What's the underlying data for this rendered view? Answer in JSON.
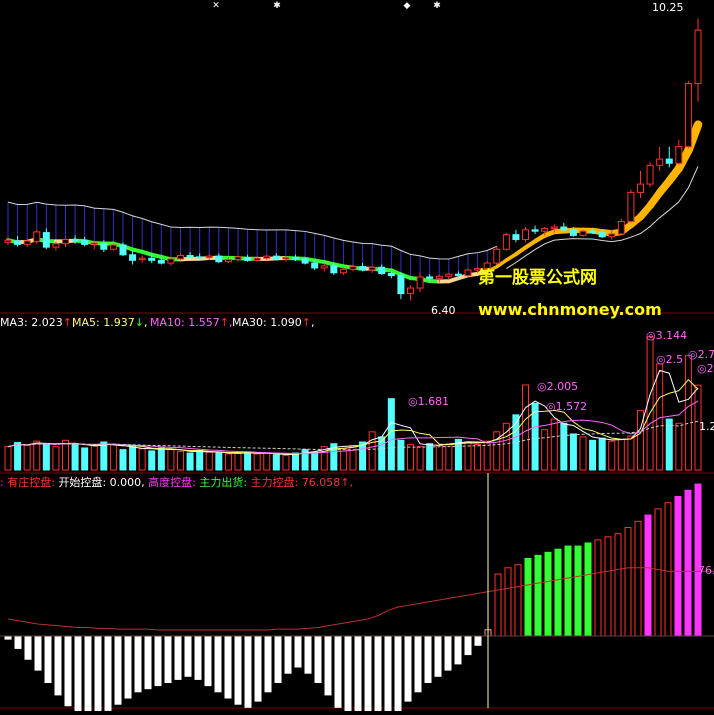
{
  "colors": {
    "background": "#000000",
    "up": "#ff3030",
    "down": "#54ffff",
    "divider": "#800000",
    "green": "#33ff33",
    "gold": "#ffb400",
    "magenta": "#ff33ff",
    "white": "#ffffff",
    "band": "#3030c8",
    "cursor": "#ffffa0"
  },
  "watermark": {
    "line1": "第一股票公式网",
    "line2": "www.chnmoney.com"
  },
  "chart_data": [
    {
      "type": "candlestick",
      "panel": "price",
      "annotations": {
        "high": "10.25",
        "low": "6.40"
      },
      "ylim": [
        6.0,
        10.4
      ],
      "candles": [
        [
          7.02,
          7.1,
          6.98,
          7.05
        ],
        [
          7.04,
          7.11,
          6.96,
          6.99
        ],
        [
          6.99,
          7.06,
          6.95,
          7.04
        ],
        [
          7.03,
          7.2,
          7.0,
          7.17
        ],
        [
          7.16,
          7.22,
          6.92,
          6.95
        ],
        [
          6.95,
          7.03,
          6.9,
          7.0
        ],
        [
          7.0,
          7.08,
          6.95,
          7.06
        ],
        [
          7.06,
          7.12,
          7.0,
          7.04
        ],
        [
          7.05,
          7.1,
          6.96,
          6.99
        ],
        [
          6.99,
          7.04,
          6.92,
          7.01
        ],
        [
          7.0,
          7.05,
          6.88,
          6.92
        ],
        [
          6.92,
          7.0,
          6.9,
          6.98
        ],
        [
          6.98,
          7.02,
          6.82,
          6.84
        ],
        [
          6.84,
          6.9,
          6.7,
          6.76
        ],
        [
          6.77,
          6.83,
          6.72,
          6.79
        ],
        [
          6.79,
          6.85,
          6.72,
          6.76
        ],
        [
          6.76,
          6.8,
          6.7,
          6.72
        ],
        [
          6.72,
          6.8,
          6.68,
          6.78
        ],
        [
          6.78,
          6.86,
          6.76,
          6.83
        ],
        [
          6.83,
          6.88,
          6.78,
          6.81
        ],
        [
          6.81,
          6.86,
          6.76,
          6.8
        ],
        [
          6.8,
          6.85,
          6.76,
          6.82
        ],
        [
          6.82,
          6.86,
          6.72,
          6.74
        ],
        [
          6.74,
          6.8,
          6.72,
          6.77
        ],
        [
          6.77,
          6.83,
          6.74,
          6.81
        ],
        [
          6.8,
          6.84,
          6.74,
          6.76
        ],
        [
          6.76,
          6.82,
          6.74,
          6.79
        ],
        [
          6.79,
          6.84,
          6.76,
          6.82
        ],
        [
          6.82,
          6.86,
          6.76,
          6.78
        ],
        [
          6.78,
          6.82,
          6.74,
          6.8
        ],
        [
          6.8,
          6.84,
          6.75,
          6.78
        ],
        [
          6.78,
          6.8,
          6.7,
          6.72
        ],
        [
          6.72,
          6.76,
          6.62,
          6.65
        ],
        [
          6.65,
          6.72,
          6.6,
          6.68
        ],
        [
          6.68,
          6.72,
          6.55,
          6.58
        ],
        [
          6.58,
          6.66,
          6.55,
          6.63
        ],
        [
          6.63,
          6.7,
          6.6,
          6.67
        ],
        [
          6.67,
          6.72,
          6.6,
          6.62
        ],
        [
          6.62,
          6.68,
          6.58,
          6.66
        ],
        [
          6.66,
          6.7,
          6.55,
          6.57
        ],
        [
          6.57,
          6.6,
          6.5,
          6.54
        ],
        [
          6.54,
          6.58,
          6.2,
          6.28
        ],
        [
          6.28,
          6.4,
          6.18,
          6.36
        ],
        [
          6.36,
          6.58,
          6.3,
          6.52
        ],
        [
          6.52,
          6.56,
          6.46,
          6.5
        ],
        [
          6.5,
          6.55,
          6.44,
          6.53
        ],
        [
          6.53,
          6.58,
          6.48,
          6.56
        ],
        [
          6.56,
          6.6,
          6.5,
          6.54
        ],
        [
          6.54,
          6.64,
          6.52,
          6.62
        ],
        [
          6.62,
          6.66,
          6.58,
          6.64
        ],
        [
          6.64,
          6.75,
          6.62,
          6.72
        ],
        [
          6.72,
          6.95,
          6.7,
          6.92
        ],
        [
          6.92,
          7.16,
          6.9,
          7.13
        ],
        [
          7.13,
          7.2,
          7.02,
          7.06
        ],
        [
          7.06,
          7.24,
          7.02,
          7.2
        ],
        [
          7.2,
          7.26,
          7.14,
          7.18
        ],
        [
          7.18,
          7.24,
          7.12,
          7.22
        ],
        [
          7.22,
          7.28,
          7.16,
          7.24
        ],
        [
          7.24,
          7.3,
          7.18,
          7.2
        ],
        [
          7.2,
          7.24,
          7.1,
          7.12
        ],
        [
          7.12,
          7.2,
          7.1,
          7.18
        ],
        [
          7.18,
          7.22,
          7.14,
          7.16
        ],
        [
          7.16,
          7.2,
          7.08,
          7.1
        ],
        [
          7.1,
          7.2,
          7.06,
          7.14
        ],
        [
          7.14,
          7.36,
          7.12,
          7.32
        ],
        [
          7.32,
          7.78,
          7.3,
          7.74
        ],
        [
          7.74,
          8.05,
          7.66,
          7.86
        ],
        [
          7.86,
          8.18,
          7.82,
          8.13
        ],
        [
          8.13,
          8.4,
          8.05,
          8.22
        ],
        [
          8.22,
          8.4,
          8.1,
          8.16
        ],
        [
          8.16,
          8.5,
          8.14,
          8.4
        ],
        [
          8.4,
          9.35,
          8.38,
          9.31
        ],
        [
          9.31,
          10.25,
          9.05,
          10.08
        ]
      ],
      "overlays": [
        "upper-band",
        "lower-band",
        "middle-trend"
      ]
    },
    {
      "type": "bar",
      "panel": "volume",
      "legend": [
        {
          "name": "MA3",
          "value": "2.023",
          "arrow": "↑"
        },
        {
          "name": "MA5",
          "value": "1.937",
          "arrow": "↓"
        },
        {
          "name": "MA10",
          "value": "1.557",
          "arrow": "↑"
        },
        {
          "name": "MA30",
          "value": "1.090",
          "arrow": "↑"
        }
      ],
      "ylim": [
        0,
        3.3
      ],
      "annotations": [
        "1.681",
        "2.005",
        "1.572",
        "3.144",
        "2.5",
        "2.7",
        "2.",
        "1.2"
      ],
      "values": [
        0.55,
        0.65,
        0.58,
        0.68,
        0.62,
        0.55,
        0.7,
        0.6,
        0.52,
        0.58,
        0.66,
        0.6,
        0.48,
        0.55,
        0.5,
        0.45,
        0.52,
        0.48,
        0.44,
        0.4,
        0.46,
        0.42,
        0.4,
        0.38,
        0.4,
        0.42,
        0.38,
        0.4,
        0.36,
        0.34,
        0.4,
        0.48,
        0.42,
        0.55,
        0.62,
        0.5,
        0.58,
        0.66,
        0.9,
        0.78,
        1.681,
        0.7,
        0.6,
        0.55,
        0.62,
        0.58,
        0.62,
        0.72,
        0.66,
        0.6,
        0.68,
        0.9,
        1.1,
        1.3,
        2.005,
        1.572,
        0.95,
        1.2,
        1.1,
        0.85,
        0.78,
        0.7,
        0.75,
        0.68,
        0.72,
        0.8,
        1.4,
        3.144,
        2.5,
        1.2,
        1.1,
        2.7,
        2.0
      ]
    },
    {
      "type": "bar",
      "panel": "indicator",
      "legend": [
        {
          "name": "有庄控盘",
          "value": "",
          "color": "#ff3030"
        },
        {
          "name": "开始控盘",
          "value": "0.000",
          "color": "#ffffff"
        },
        {
          "name": "高度控盘",
          "value": "",
          "color": "#ff33ff"
        },
        {
          "name": "主力出货",
          "value": "",
          "color": "#33ff33"
        },
        {
          "name": "主力控盘",
          "value": "76.058",
          "arrow": "↑",
          "color": "#ff3030"
        }
      ],
      "ylim": [
        -80,
        100
      ],
      "annotations": [
        "76."
      ],
      "values": [
        -2,
        -8,
        -15,
        -22,
        -30,
        -38,
        -45,
        -50,
        -55,
        -52,
        -48,
        -44,
        -40,
        -36,
        -34,
        -32,
        -30,
        -28,
        -26,
        -28,
        -32,
        -36,
        -40,
        -44,
        -46,
        -42,
        -36,
        -30,
        -24,
        -20,
        -24,
        -30,
        -38,
        -46,
        -56,
        -64,
        -70,
        -68,
        -60,
        -50,
        -42,
        -36,
        -30,
        -26,
        -22,
        -18,
        -12,
        -6,
        4,
        40,
        44,
        46,
        50,
        52,
        54,
        56,
        58,
        58,
        60,
        62,
        64,
        66,
        70,
        74,
        78,
        82,
        86,
        90,
        94,
        98
      ],
      "line": [
        20,
        18,
        16,
        14,
        13,
        12,
        11,
        10,
        10,
        9,
        9,
        8,
        8,
        8,
        8,
        7,
        7,
        7,
        7,
        7,
        7,
        7,
        7,
        7,
        7,
        7,
        7,
        8,
        8,
        8,
        9,
        10,
        12,
        14,
        16,
        18,
        20,
        24,
        30,
        34,
        36,
        38,
        40,
        42,
        44,
        46,
        48,
        50,
        52,
        54,
        56,
        58,
        60,
        62,
        64,
        66,
        68,
        70,
        72,
        74,
        76,
        78,
        80,
        80,
        80,
        78,
        76,
        76,
        76,
        76,
        76,
        76
      ],
      "cursor_index": 48
    }
  ]
}
